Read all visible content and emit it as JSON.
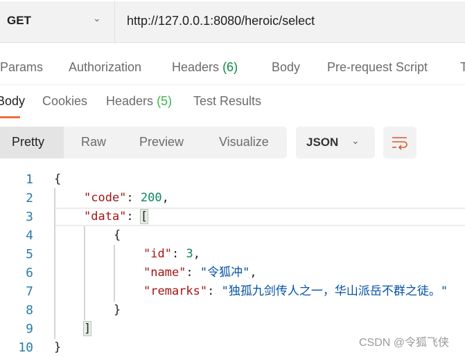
{
  "request": {
    "method": "GET",
    "url": "http://127.0.0.1:8080/heroic/select"
  },
  "request_tabs": [
    {
      "label": "Params"
    },
    {
      "label": "Authorization"
    },
    {
      "label": "Headers",
      "count": "(6)"
    },
    {
      "label": "Body"
    },
    {
      "label": "Pre-request Script"
    },
    {
      "label": "T"
    }
  ],
  "response_tabs": [
    {
      "label": "Body",
      "active": true
    },
    {
      "label": "Cookies"
    },
    {
      "label": "Headers",
      "count": "(5)"
    },
    {
      "label": "Test Results"
    }
  ],
  "view_modes": [
    "Pretty",
    "Raw",
    "Preview",
    "Visualize"
  ],
  "selected_view": "Pretty",
  "format": "JSON",
  "icons": {
    "method_dropdown": "chevron-down-icon",
    "format_dropdown": "chevron-down-icon",
    "wrap": "wrap-lines-icon"
  },
  "accent_color": "#f26b3a",
  "code": {
    "line_numbers": [
      "1",
      "2",
      "3",
      "4",
      "5",
      "6",
      "7",
      "8",
      "9",
      "10"
    ],
    "lines": [
      [
        {
          "t": "p",
          "v": "{"
        }
      ],
      [
        {
          "t": "k",
          "v": "\"code\""
        },
        {
          "t": "p",
          "v": ": "
        },
        {
          "t": "n",
          "v": "200"
        },
        {
          "t": "p",
          "v": ","
        }
      ],
      [
        {
          "t": "k",
          "v": "\"data\""
        },
        {
          "t": "p",
          "v": ": "
        },
        {
          "t": "b",
          "v": "["
        }
      ],
      [
        {
          "t": "p",
          "v": "{"
        }
      ],
      [
        {
          "t": "k",
          "v": "\"id\""
        },
        {
          "t": "p",
          "v": ": "
        },
        {
          "t": "n",
          "v": "3"
        },
        {
          "t": "p",
          "v": ","
        }
      ],
      [
        {
          "t": "k",
          "v": "\"name\""
        },
        {
          "t": "p",
          "v": ": "
        },
        {
          "t": "s",
          "v": "\"令狐冲\""
        },
        {
          "t": "p",
          "v": ","
        }
      ],
      [
        {
          "t": "k",
          "v": "\"remarks\""
        },
        {
          "t": "p",
          "v": ": "
        },
        {
          "t": "s",
          "v": "\"独孤九剑传人之一，华山派岳不群之徒。\""
        }
      ],
      [
        {
          "t": "p",
          "v": "}"
        }
      ],
      [
        {
          "t": "b",
          "v": "]"
        }
      ],
      [
        {
          "t": "p",
          "v": "}"
        }
      ]
    ],
    "indents": [
      0,
      1,
      1,
      2,
      3,
      3,
      3,
      2,
      1,
      0
    ]
  },
  "watermark": "CSDN @令狐飞侠"
}
